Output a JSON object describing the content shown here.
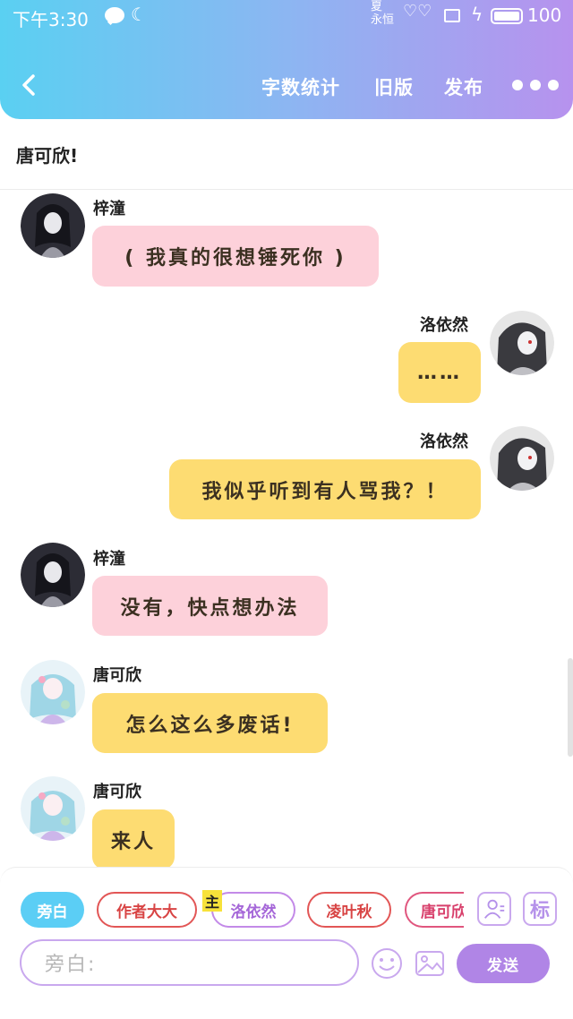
{
  "status_bar": {
    "time": "下午3:30",
    "battery": "100",
    "logo_text": "夏\n永恒"
  },
  "header": {
    "word_count": "字数统计",
    "old_version": "旧版",
    "publish": "发布"
  },
  "story_title": "唐可欣!",
  "messages": [
    {
      "name": "梓潼",
      "text": "( 我真的很想锤死你 )",
      "side": "left",
      "color": "pink"
    },
    {
      "name": "洛依然",
      "text": "……",
      "side": "right",
      "color": "yellow"
    },
    {
      "name": "洛依然",
      "text": "我似乎听到有人骂我？！",
      "side": "right",
      "color": "yellow"
    },
    {
      "name": "梓潼",
      "text": "没有，快点想办法",
      "side": "left",
      "color": "pink"
    },
    {
      "name": "唐可欣",
      "text": "怎么这么多废话!",
      "side": "left",
      "color": "yellow"
    },
    {
      "name": "唐可欣",
      "text": "来人",
      "side": "left",
      "color": "yellow"
    }
  ],
  "roles": {
    "narration": "旁白",
    "author": "作者大大",
    "luo": "洛依然",
    "ling": "凌叶秋",
    "tang": "唐可欣"
  },
  "main_tag": "主",
  "tools": {
    "mark": "标"
  },
  "input": {
    "placeholder": "旁白:"
  },
  "send_label": "发送",
  "colors": {
    "header_gradient_start": "#5ad0f2",
    "header_gradient_end": "#b792ee",
    "bubble_pink": "#fdd1da",
    "bubble_yellow": "#fddc72",
    "accent_purple": "#b085e6",
    "narration_blue": "#5bcef5"
  },
  "icons": {
    "back": "chevron-left-icon",
    "more": "more-dots-icon",
    "role_card": "role-card-icon",
    "emoji": "emoji-face-icon",
    "image": "image-icon"
  }
}
